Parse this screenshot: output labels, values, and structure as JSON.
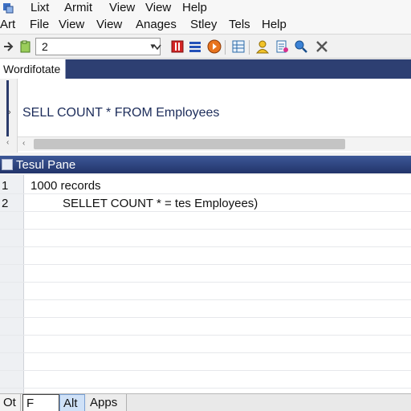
{
  "menus": {
    "top": [
      "Lixt",
      "Armit",
      "View",
      "View",
      "Help"
    ],
    "second": [
      "Art",
      "File",
      "View",
      "View",
      "Anages",
      "Stley",
      "Tels",
      "Help"
    ]
  },
  "toolbar": {
    "combo_value": "2"
  },
  "worksheet": {
    "tab_label": "Wordifotate",
    "sql_text": "SELL COUNT * FROM Employees"
  },
  "results": {
    "title": "Tesul Pane",
    "rows": [
      {
        "num": "1",
        "text": "1000 records"
      },
      {
        "num": "2",
        "text": "SELLET COUNT * = tes  Employees)"
      }
    ]
  },
  "bottom_tabs": {
    "status": "Ot",
    "f": "F",
    "alt": "Alt",
    "apps": "Apps"
  },
  "colors": {
    "accent_dark_blue": "#2d3f72",
    "header_blue": "#3d5897",
    "sql_text": "#1c2c5a"
  }
}
